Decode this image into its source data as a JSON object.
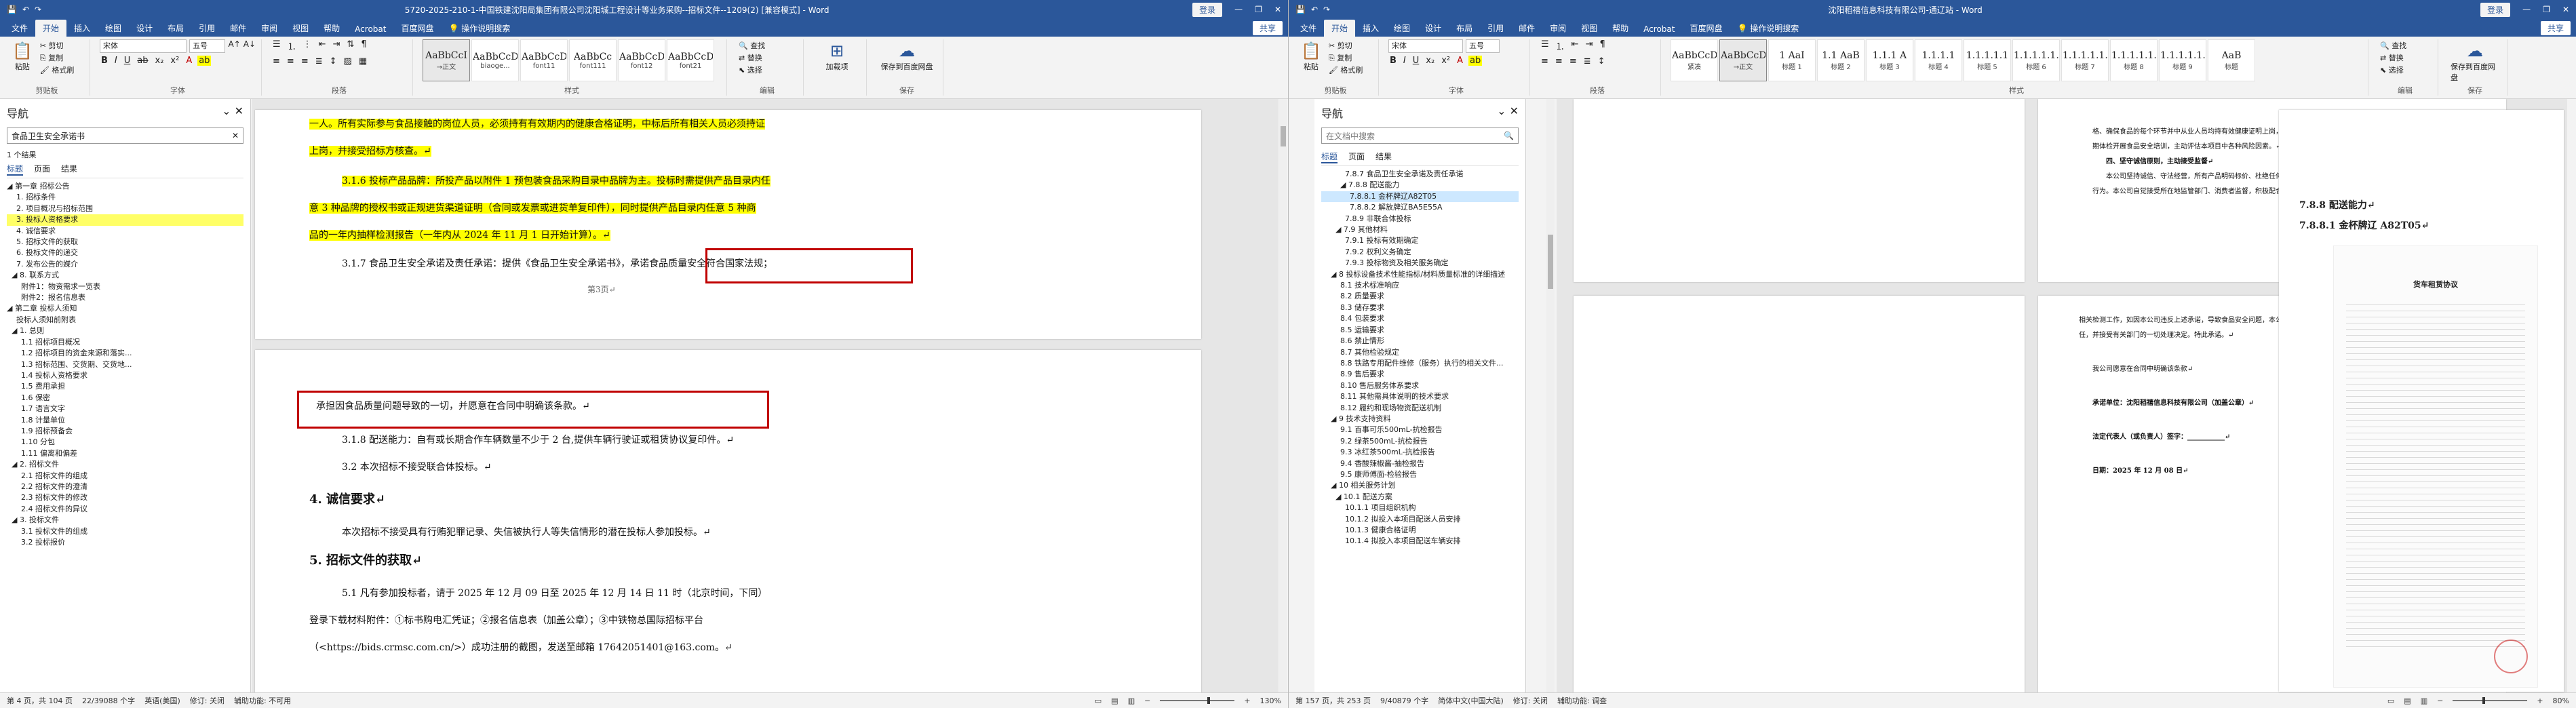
{
  "left": {
    "title": "5720-2025-210-1-中国铁建沈阳局集团有限公司沈阳城工程设计等业务采购--招标文件--1209(2) [兼容模式] - Word",
    "login": "登录",
    "tabs": [
      "文件",
      "开始",
      "插入",
      "绘图",
      "设计",
      "布局",
      "引用",
      "邮件",
      "审阅",
      "视图",
      "帮助",
      "Acrobat",
      "百度网盘",
      "操作说明搜索"
    ],
    "share": "共享",
    "ribbon": {
      "paste": "粘贴",
      "cut": "剪切",
      "copy": "复制",
      "format_painter": "格式刷",
      "clipboard": "剪贴板",
      "font_name": "宋体",
      "font_size": "五号",
      "font": "字体",
      "paragraph": "段落",
      "styles_label": "样式",
      "styles": [
        {
          "sample": "AaBbCcI",
          "name": "→正文"
        },
        {
          "sample": "AaBbCcDd",
          "name": "biaoge..."
        },
        {
          "sample": "AaBbCcDc",
          "name": "font11"
        },
        {
          "sample": "AaBbCc",
          "name": "font111"
        },
        {
          "sample": "AaBbCcDc",
          "name": "font12"
        },
        {
          "sample": "AaBbCcDc",
          "name": "font21"
        }
      ],
      "find": "查找",
      "replace": "替换",
      "select": "选择",
      "editing": "编辑",
      "add_one": "加载项",
      "save_baidu": "保存到百度网盘",
      "addins": "加载项",
      "save": "保存"
    },
    "nav": {
      "title": "导航",
      "search_value": "食品卫生安全承诺书",
      "result_count": "1 个结果",
      "tabs": [
        "标题",
        "页面",
        "结果"
      ],
      "items": [
        "◢ 第一章 招标公告",
        "    1. 招标条件",
        "    2. 项目概况与招标范围",
        "    3. 投标人资格要求",
        "    4. 诚信要求",
        "    5. 招标文件的获取",
        "    6. 投标文件的递交",
        "    7. 发布公告的媒介",
        "  ◢ 8. 联系方式",
        "      附件1：物资需求一览表",
        "      附件2：报名信息表",
        "◢ 第二章 投标人须知",
        "    投标人须知前附表",
        "  ◢ 1. 总则",
        "      1.1 招标项目概况",
        "      1.2 招标项目的资金来源和落实...",
        "      1.3 招标范围、交货期、交货地...",
        "      1.4 投标人资格要求",
        "      1.5 费用承担",
        "      1.6 保密",
        "      1.7 语言文字",
        "      1.8 计量单位",
        "      1.9 招标预备会",
        "      1.10 分包",
        "      1.11 偏离和偏差",
        "  ◢ 2. 招标文件",
        "      2.1 招标文件的组成",
        "      2.2 招标文件的澄清",
        "      2.3 招标文件的修改",
        "      2.4 招标文件的异议",
        "  ◢ 3. 投标文件",
        "      3.1 投标文件的组成",
        "      3.2 投标报价"
      ],
      "highlighted": [
        3
      ]
    },
    "page1": {
      "lines": [
        "一人。所有实际参与食品接触的岗位人员，必须持有有效期内的健康合格证明，中标后所有相关人员必须持证",
        "上岗，并接受招标方核查。↵",
        "3.1.6 投标产品品牌：所投产品以附件 1 预包装食品采购目录中品牌为主。投标时需提供产品目录内任",
        "意 3 种品牌的授权书或正规进货渠道证明（合同或发票或进货单复印件），同时提供产品目录内任意 5 种商",
        "品的一年内抽样检测报告（一年内从 2024 年 11 月 1 日开始计算）。↵",
        "3.1.7 食品卫生安全承诺及责任承诺：提供《食品卫生安全承诺书》，承诺食品质量安全符合国家法规；"
      ],
      "page_footer": "第3页↵"
    },
    "page2": {
      "lines": [
        "承担因食品质量问题导致的一切，并愿意在合同中明确该条款。↵",
        "3.1.8 配送能力：自有或长期合作车辆数量不少于 2 台,提供车辆行驶证或租赁协议复印件。↵",
        "3.2 本次招标不接受联合体投标。↵",
        "4. 诚信要求↵",
        "本次招标不接受具有行贿犯罪记录、失信被执行人等失信情形的潜在投标人参加投标。↵",
        "5. 招标文件的获取↵",
        "5.1 凡有参加投标者，请于 2025 年 12 月 09 日至 2025 年 12 月 14 日 11 时（北京时间，下同）",
        "登录下载材料附件：①标书购电汇凭证；②报名信息表（加盖公章）；③中铁物总国际招标平台",
        "（<https://bids.crmsc.com.cn/>）成功注册的截图，发送至邮箱 17642051401@163.com。↵"
      ]
    },
    "status": {
      "page": "第 4 页，共 104 页",
      "words": "22/39088 个字",
      "lang": "英语(美国)",
      "macro": "修订: 关闭",
      "access": "辅助功能: 不可用",
      "zoom": "130%"
    }
  },
  "right": {
    "title": "沈阳稻禧信息科技有限公司-通辽站 - Word",
    "login": "登录",
    "tabs": [
      "文件",
      "开始",
      "插入",
      "绘图",
      "设计",
      "布局",
      "引用",
      "邮件",
      "审阅",
      "视图",
      "帮助",
      "Acrobat",
      "百度网盘",
      "操作说明搜索"
    ],
    "share": "共享",
    "ribbon": {
      "paste": "粘贴",
      "cut": "剪切",
      "copy": "复制",
      "format_painter": "格式刷",
      "clipboard": "剪贴板",
      "font_name": "宋体",
      "font_size": "五号",
      "font": "字体",
      "paragraph": "段落",
      "styles_label": "样式",
      "styles": [
        {
          "sample": "AaBbCcD",
          "name": "紧凑"
        },
        {
          "sample": "AaBbCcD",
          "name": "→正文"
        },
        {
          "sample": "1 AaI",
          "name": "标题 1"
        },
        {
          "sample": "1.1 AaB",
          "name": "标题 2"
        },
        {
          "sample": "1.1.1 A",
          "name": "标题 3"
        },
        {
          "sample": "1.1.1.1",
          "name": "标题 4"
        },
        {
          "sample": "1.1.1.1.1",
          "name": "标题 5"
        },
        {
          "sample": "1.1.1.1.1.1",
          "name": "标题 6"
        },
        {
          "sample": "1.1.1.1.1.1.",
          "name": "标题 7"
        },
        {
          "sample": "1.1.1.1.1.1.",
          "name": "标题 8"
        },
        {
          "sample": "1.1.1.1.1.",
          "name": "标题 9"
        },
        {
          "sample": "AaB",
          "name": "标题"
        }
      ],
      "find": "查找",
      "replace": "替换",
      "select": "选择",
      "editing": "编辑",
      "save_baidu": "保存到百度网盘",
      "save": "保存"
    },
    "nav": {
      "title": "导航",
      "search_placeholder": "在文档中搜索",
      "tabs": [
        "标题",
        "页面",
        "结果"
      ],
      "items": [
        "          7.8.7 食品卫生安全承诺及责任承诺",
        "        ◢ 7.8.8 配送能力",
        "            7.8.8.1 金杯牌辽A82T05",
        "            7.8.8.2 解放牌辽BA5E55A",
        "          7.8.9 非联合体投标",
        "      ◢ 7.9 其他材料",
        "          7.9.1 投标有效期确定",
        "          7.9.2 权利义务确定",
        "          7.9.3 投标物资及相关服务确定",
        "    ◢ 8 投标设备技术性能指标/材料质量标准的详细描述",
        "        8.1 技术标准响应",
        "        8.2 质量要求",
        "        8.3 储存要求",
        "        8.4 包装要求",
        "        8.5 运输要求",
        "        8.6 禁止情形",
        "        8.7 其他检验规定",
        "        8.8 铁路专用配件维修（服务）执行的相关文件...",
        "        8.9 售后要求",
        "        8.10 售后服务体系要求",
        "        8.11 其他需具体说明的技术要求",
        "        8.12 履约和现场物资配送机制",
        "    ◢ 9 技术支持资料",
        "        9.1 百事可乐500mL-抗检报告",
        "        9.2 绿茶500mL-抗检报告",
        "        9.3 冰红茶500mL-抗检报告",
        "        9.4 香酸辣椒酱-抽检报告",
        "        9.5 康师傅面-检验报告",
        "    ◢ 10 相关服务计划",
        "      ◢ 10.1 配送方案",
        "          10.1.1 项目组织机构",
        "          10.1.2 拟投入本项目配送人员安排",
        "          10.1.3 健康合格证明",
        "          10.1.4 拟投入本项目配送车辆安排"
      ],
      "selected": [
        2
      ]
    },
    "pageA": {
      "lines": [
        "格、确保食品的每个环节并中从业人员均持有效健康证明上岗，并保持良好的个人卫生习惯，定",
        "期体检开展食品安全培训，主动评估本项目中各种风险因素。↵",
        "四、坚守诚信原则，主动接受监督↵",
        "本公司坚持诚信、守法经营，所有产品明码标价、杜绝任何形式的虚假宣传和商业欺诈",
        "行为。本公司自觉接受所在地监管部门、消费者监督，积极配合监管部门的各项检查与抽"
      ]
    },
    "pageB": {
      "lines": [
        "相关检测工作，如因本公司违反上述承诺，导致食品安全问题，本公司愿意承担相应的法律责",
        "任，并接受有关部门的一切处理决定。特此承诺。↵",
        "",
        "我公司愿意在合同中明确该条款↵",
        "",
        "承诺单位：沈阳稻禧信息科技有限公司（加盖公章）↵",
        "",
        "法定代表人（或负责人）签字：___________↵",
        "",
        "日期：2025 年 12 月 08 日↵"
      ]
    },
    "pageC": {
      "heading1": "7.8.8 配送能力↵",
      "heading2": "7.8.8.1 金杯牌辽 A82T05↵",
      "doc_title": "货车租赁协议"
    },
    "status": {
      "page": "第 157 页，共 253 页",
      "words": "9/40879 个字",
      "lang": "简体中文(中国大陆)",
      "macro": "修订: 关闭",
      "access": "辅助功能: 调查",
      "zoom": "80%"
    }
  }
}
